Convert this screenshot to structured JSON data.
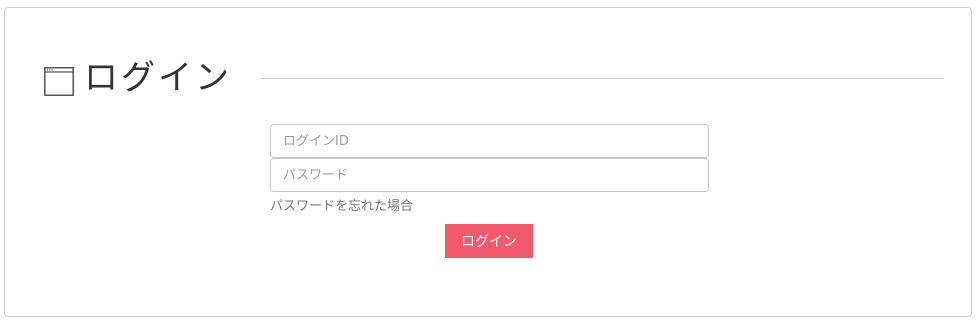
{
  "header": {
    "icon": "browser-window-icon",
    "title": "ログイン"
  },
  "form": {
    "login_id": {
      "placeholder": "ログインID",
      "value": ""
    },
    "password": {
      "placeholder": "パスワード",
      "value": ""
    },
    "forgot_password_label": "パスワードを忘れた場合",
    "submit_label": "ログイン"
  },
  "colors": {
    "accent": "#f0596e",
    "border": "#cfcfcf",
    "text": "#333333",
    "muted": "#777777"
  }
}
